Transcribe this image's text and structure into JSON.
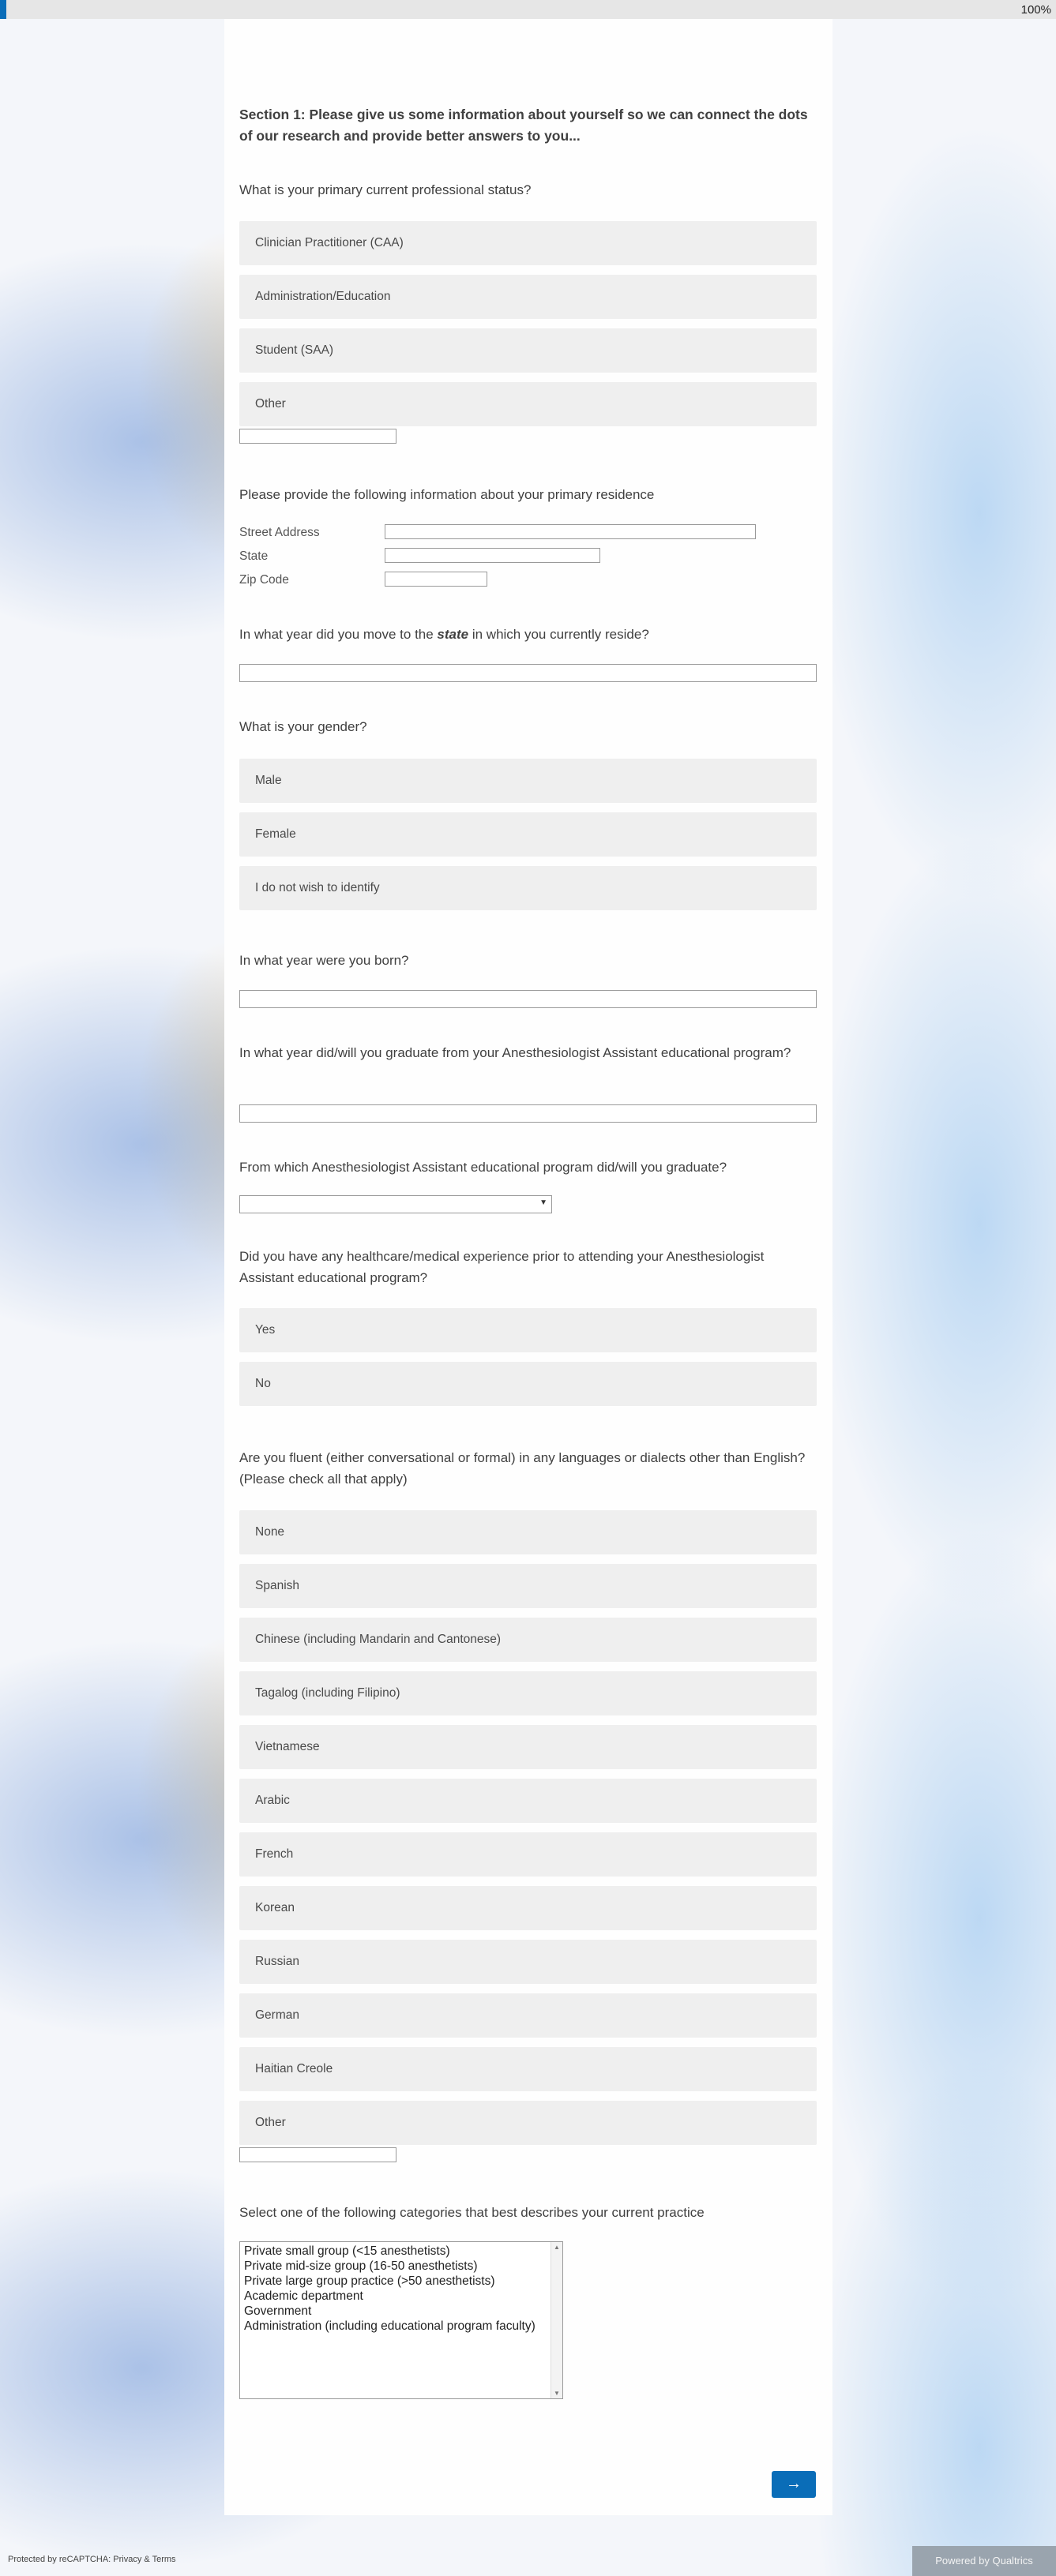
{
  "progress": {
    "percent_text": "100%",
    "fill_fraction": 0.01
  },
  "section1": {
    "heading": "Section 1: Please give us some information about yourself so we can connect the dots of our research and provide better answers to you..."
  },
  "q_status": {
    "text": "What is your primary current professional status?",
    "choices": [
      "Clinician Practitioner (CAA)",
      "Administration/Education",
      "Student (SAA)",
      "Other"
    ],
    "other_value": ""
  },
  "q_residence": {
    "text": "Please provide the following information about your primary residence",
    "fields": [
      "Street Address",
      "State",
      "Zip Code"
    ]
  },
  "q_moveyear": {
    "text_before": "In what year did you move to the ",
    "text_emph": "state",
    "text_after": " in which you currently reside?"
  },
  "q_gender": {
    "text": "What is your gender?",
    "choices": [
      "Male",
      "Female",
      "I do not wish to identify"
    ]
  },
  "q_born": {
    "text": "In what year were you born?"
  },
  "q_graduate_year": {
    "text": "In what year did/will you graduate from your Anesthesiologist Assistant educational program?"
  },
  "q_program": {
    "text": "From which Anesthesiologist Assistant educational program did/will you graduate?",
    "selected": ""
  },
  "q_experience": {
    "text": "Did you have any healthcare/medical experience prior to attending your Anesthesiologist Assistant educational program?",
    "choices": [
      "Yes",
      "No"
    ]
  },
  "q_languages": {
    "text": "Are you fluent (either conversational or formal) in any languages or dialects other than English? (Please check all that apply)",
    "choices": [
      "None",
      "Spanish",
      "Chinese (including Mandarin and Cantonese)",
      "Tagalog (including Filipino)",
      "Vietnamese",
      "Arabic",
      "French",
      "Korean",
      "Russian",
      "German",
      "Haitian Creole",
      "Other"
    ]
  },
  "q_practice": {
    "text": "Select one of the following categories that best describes your current practice",
    "options": [
      "Private small group (<15 anesthetists)",
      "Private mid-size group (16-50 anesthetists)",
      "Private large group practice (>50 anesthetists)",
      "Academic department",
      "Government",
      "Administration (including educational program faculty)"
    ]
  },
  "navigation": {
    "next_label": "→"
  },
  "footer": {
    "recaptcha": "Protected by reCAPTCHA: Privacy & Terms",
    "powered_by": "Powered by Qualtrics"
  },
  "colors": {
    "accent": "#0a6db8",
    "choice_bg": "#efefef"
  }
}
